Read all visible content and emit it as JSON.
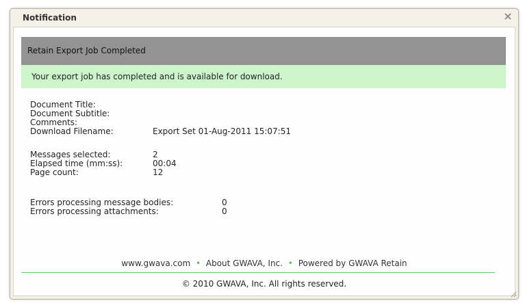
{
  "dialog": {
    "title": "Notification",
    "close_symbol": "×"
  },
  "header_bar": {
    "text": "Retain Export Job Completed"
  },
  "success_bar": {
    "text": "Your export job has completed and is available for download."
  },
  "fields": {
    "document_title_label": "Document Title:",
    "document_subtitle_label": "Document Subtitle:",
    "comments_label": "Comments:",
    "download_filename_label": "Download Filename:",
    "download_filename_value": "Export Set 01-Aug-2011 15:07:51",
    "messages_selected_label": "Messages selected:",
    "messages_selected_value": "2",
    "elapsed_time_label": "Elapsed time (mm:ss):",
    "elapsed_time_value": "00:04",
    "page_count_label": "Page count:",
    "page_count_value": "12",
    "errors_bodies_label": "Errors processing message bodies:",
    "errors_bodies_value": "0",
    "errors_attachments_label": "Errors processing attachments:",
    "errors_attachments_value": "0"
  },
  "footer": {
    "link_website": "www.gwava.com",
    "link_about": "About GWAVA, Inc.",
    "link_powered": "Powered by GWAVA Retain",
    "separator": "•",
    "copyright": "© 2010 GWAVA, Inc. All rights reserved."
  },
  "colors": {
    "header_bar": "#939393",
    "success_bar": "#ccf5cc",
    "divider": "#6cc46c",
    "frame": "#f4f1e8"
  }
}
